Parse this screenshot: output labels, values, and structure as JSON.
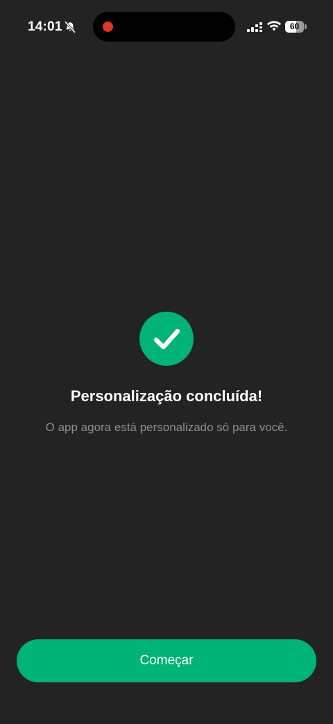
{
  "status_bar": {
    "time": "14:01",
    "battery_level": "60",
    "battery_fraction": 0.6,
    "icons": [
      "bell-slash-icon",
      "recording-dot-icon",
      "signal-icon",
      "wifi-icon",
      "battery-icon"
    ]
  },
  "completion": {
    "icon": "check-circle-icon",
    "title": "Personalização concluída!",
    "subtitle": "O app agora está personalizado só para você."
  },
  "actions": {
    "start_label": "Começar"
  },
  "colors": {
    "background": "#232323",
    "accent": "#00b377",
    "subtitle_text": "#8f8f8f",
    "record_dot": "#e0342c"
  }
}
